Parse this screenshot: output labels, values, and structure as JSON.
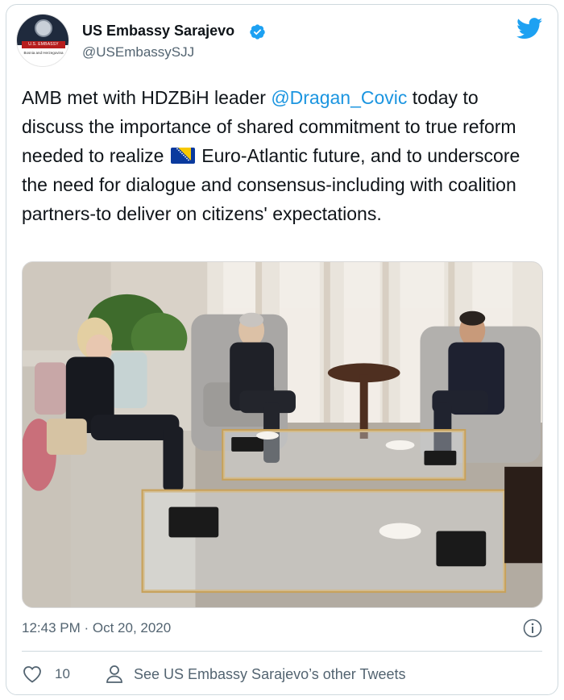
{
  "account": {
    "display_name": "US Embassy Sarajevo",
    "handle": "@USEmbassySJJ",
    "avatar_band_text": "U.S. EMBASSY",
    "avatar_sub_text": "Bosnia and Herzegovina",
    "verified_icon": "verified-badge-icon"
  },
  "tweet": {
    "text_part1": "AMB met with HDZBiH leader ",
    "mention": "@Dragan_Covic",
    "text_part2": " today to discuss the importance of shared commitment to true reform needed to realize ",
    "flag_emoji": "bosnia-herzegovina-flag",
    "text_part3": " Euro-Atlantic future, and to underscore the need for dialogue and consensus-including with coalition partners-to deliver on citizens' expectations.",
    "timestamp": "12:43 PM · Oct 20, 2020"
  },
  "actions": {
    "like_count": "10",
    "other_tweets_label": "See US Embassy Sarajevo’s other Tweets"
  },
  "colors": {
    "twitter_blue": "#1da1f2",
    "mention_blue": "#1b95e0",
    "secondary_text": "#536471"
  }
}
